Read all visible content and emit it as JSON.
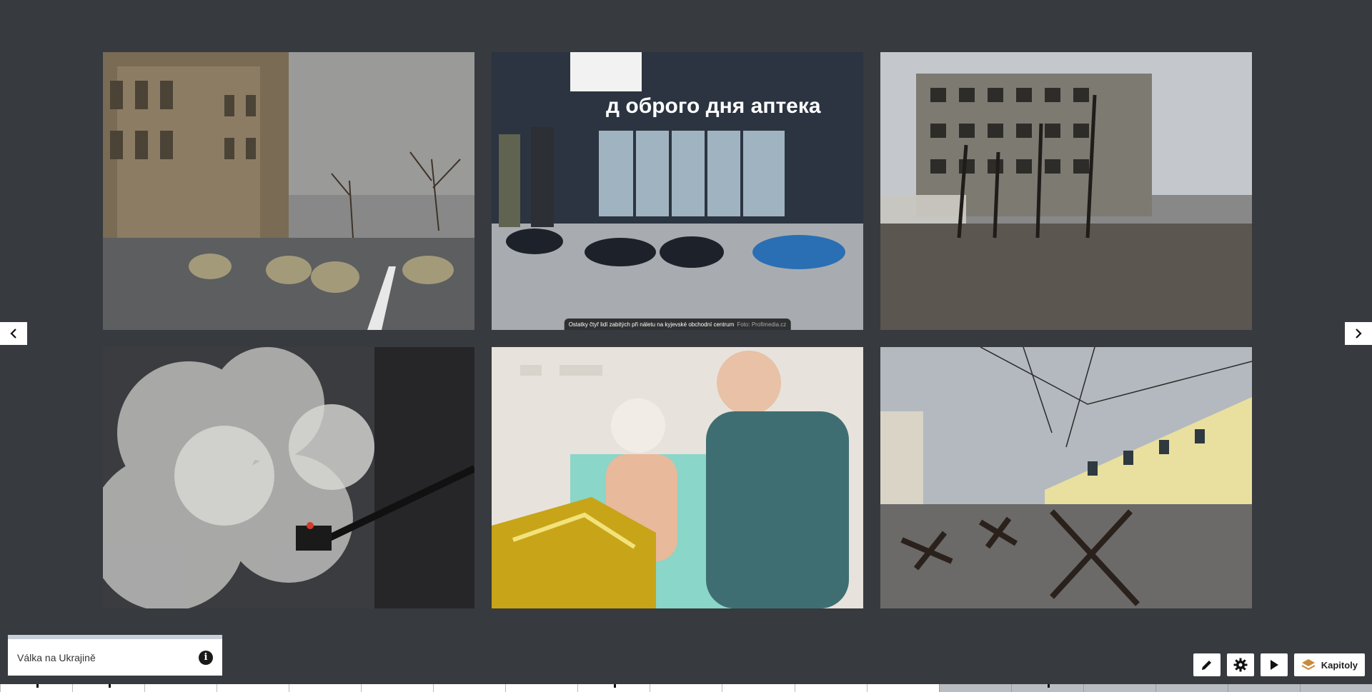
{
  "gallery": {
    "photos": [
      {
        "alt": "Street with concrete anti-tank blocks"
      },
      {
        "alt": "Shopping centre entrance with bodies",
        "caption": "Ostatky čtyř lidí zabitých při náletu na kyjevské obchodní centrum",
        "credit": "Foto: Profimedia.cz"
      },
      {
        "alt": "Destroyed apartment building"
      },
      {
        "alt": "Firefighters in smoke"
      },
      {
        "alt": "Injured mother in hospital"
      },
      {
        "alt": "Street with anti-tank hedgehogs"
      }
    ]
  },
  "story": {
    "title": "Válka na Ukrajině"
  },
  "toolbar": {
    "edit_icon": "pencil-icon",
    "settings_icon": "gear-icon",
    "play_icon": "play-icon",
    "chapters_icon": "layers-icon",
    "chapters_label": "Kapitoly"
  },
  "timeline": {
    "segments": 19,
    "white_segments": 13
  },
  "colors": {
    "background": "#373a3e",
    "panel": "#ffffff"
  }
}
